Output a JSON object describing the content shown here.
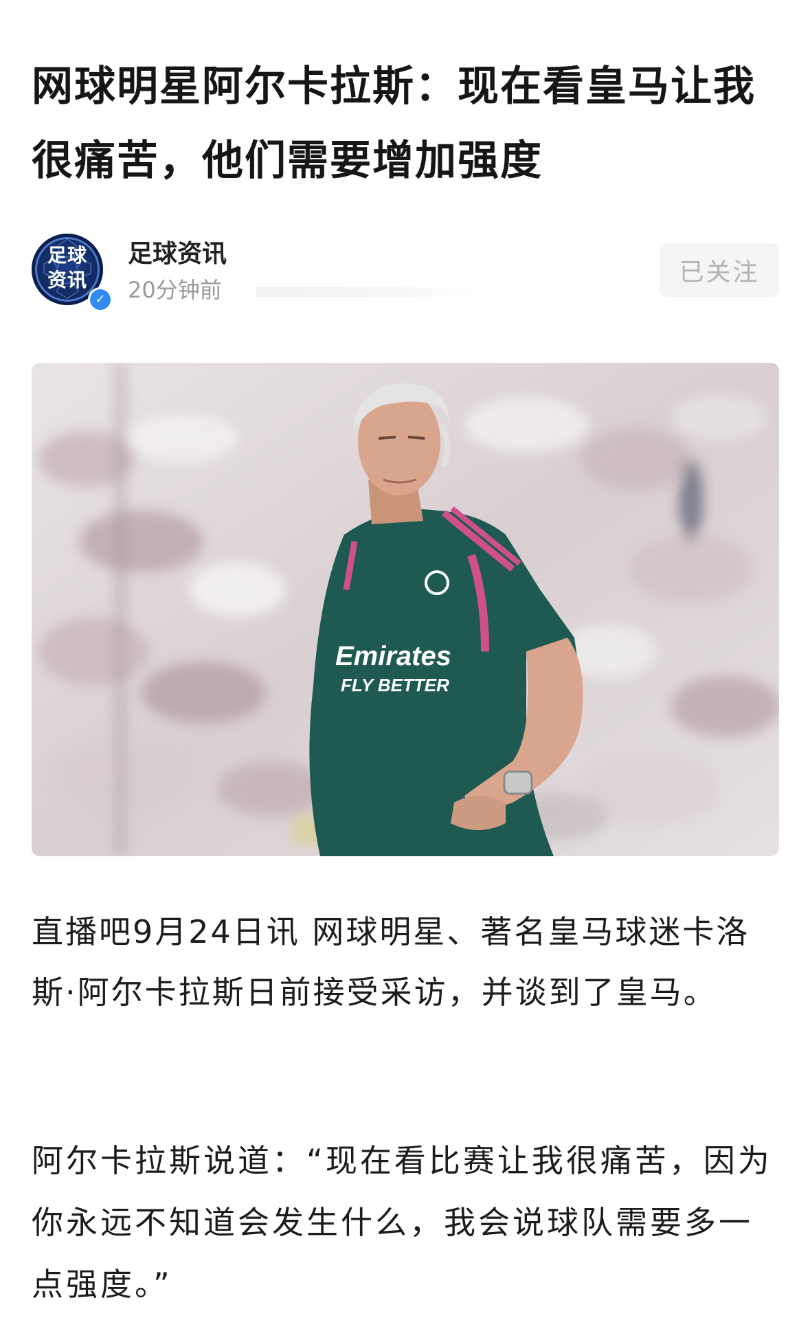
{
  "article": {
    "title": "网球明星阿尔卡拉斯：现在看皇马让我很痛苦，他们需要增加强度"
  },
  "author": {
    "name": "足球资讯",
    "time": "20分钟前",
    "follow_label": "已关注",
    "avatar_text": "足球资讯",
    "verified_icon": "verified-check-icon"
  },
  "image": {
    "jersey_sponsor_line1": "Emirates",
    "jersey_sponsor_line2": "FLY BETTER"
  },
  "content": {
    "paragraphs": [
      "直播吧9月24日讯 网球明星、著名皇马球迷卡洛斯·阿尔卡拉斯日前接受采访，并谈到了皇马。",
      "阿尔卡拉斯说道：“现在看比赛让我很痛苦，因为你永远不知道会发生什么，我会说球队需要多一点强度。”"
    ]
  },
  "colors": {
    "background": "#ffffff",
    "title": "#161616",
    "meta": "#9a9a9a",
    "follow_bg": "#f4f5f7",
    "verified": "#2f8bf0",
    "jersey": "#1f5a52",
    "jersey_accent": "#d0508a"
  }
}
